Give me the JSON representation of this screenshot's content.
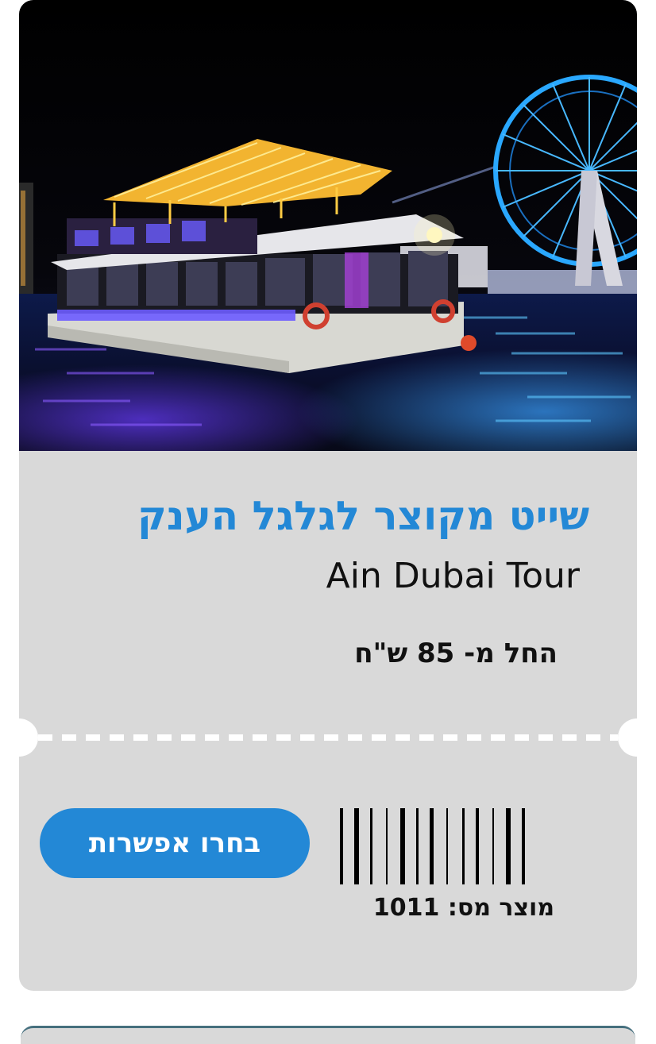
{
  "card": {
    "title_he": "שייט מקוצר לגלגל הענק",
    "title_en": "Ain Dubai Tour",
    "price_text": "החל מ- 85 ש\"ח",
    "cta_label": "בחרו אפשרות",
    "product_number": "מוצר מס: 1011"
  },
  "colors": {
    "accent": "#2388d6",
    "card_bg": "#d9d9d9",
    "text": "#111111"
  },
  "icons": {
    "barcode": "barcode-icon"
  }
}
